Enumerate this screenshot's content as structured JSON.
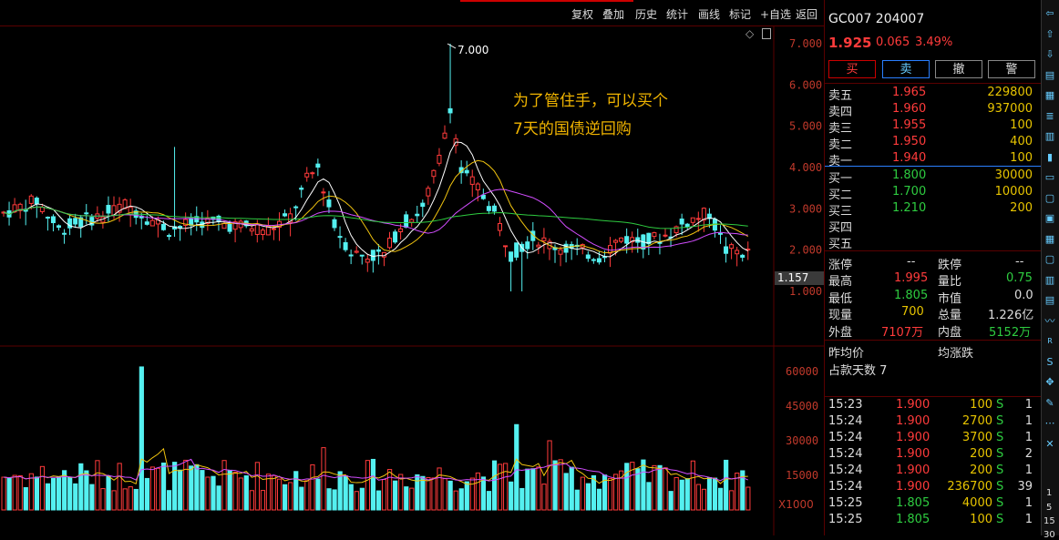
{
  "menu": [
    "复权",
    "叠加",
    "历史",
    "统计",
    "画线",
    "标记",
    "+自选",
    "返回"
  ],
  "chart": {
    "y_labels": [
      "7.000",
      "6.000",
      "5.000",
      "4.000",
      "3.000",
      "2.000",
      "1.000"
    ],
    "vol_labels": [
      "60000",
      "45000",
      "30000",
      "15000"
    ],
    "vol_unit": "X1000",
    "peak_label": "7.000",
    "current_price_tag": "1.157",
    "annotation_line1": "为了管住手，可以买个",
    "annotation_line2": "7天的国债逆回购"
  },
  "chart_data": {
    "type": "candlestick",
    "y_range": [
      0.6,
      7.2
    ],
    "volume_range": [
      0,
      65000
    ],
    "notes": "daily candlesticks with MA5/MA10/MA20/MA60 lines and volume bars"
  },
  "quote": {
    "code": "GC007 204007",
    "price": "1.925",
    "change": "0.065",
    "change_pct": "3.49%"
  },
  "actions": [
    "买",
    "卖",
    "撤",
    "警"
  ],
  "asks": [
    {
      "label": "卖五",
      "price": "1.965",
      "vol": "229800"
    },
    {
      "label": "卖四",
      "price": "1.960",
      "vol": "937000"
    },
    {
      "label": "卖三",
      "price": "1.955",
      "vol": "100"
    },
    {
      "label": "卖二",
      "price": "1.950",
      "vol": "400"
    },
    {
      "label": "卖一",
      "price": "1.940",
      "vol": "100"
    }
  ],
  "bids": [
    {
      "label": "买一",
      "price": "1.800",
      "vol": "30000"
    },
    {
      "label": "买二",
      "price": "1.700",
      "vol": "10000"
    },
    {
      "label": "买三",
      "price": "1.210",
      "vol": "200"
    },
    {
      "label": "买四",
      "price": "",
      "vol": ""
    },
    {
      "label": "买五",
      "price": "",
      "vol": ""
    }
  ],
  "stats": {
    "limit_up_label": "涨停",
    "limit_up": "--",
    "limit_down_label": "跌停",
    "limit_down": "--",
    "high_label": "最高",
    "high": "1.995",
    "ratio_label": "量比",
    "ratio": "0.75",
    "low_label": "最低",
    "low": "1.805",
    "mcap_label": "市值",
    "mcap": "0.0",
    "cur_vol_label": "现量",
    "cur_vol": "700",
    "total_vol_label": "总量",
    "total_vol": "1.226亿",
    "outer_label": "外盘",
    "outer": "7107万",
    "inner_label": "内盘",
    "inner": "5152万"
  },
  "extra": {
    "prev_avg_label": "昨均价",
    "avg_chg_label": "均涨跌",
    "days_label": "占款天数 7"
  },
  "ticks": [
    {
      "t": "15:23",
      "p": "1.900",
      "v": "100",
      "s": "S",
      "n": "1"
    },
    {
      "t": "15:24",
      "p": "1.900",
      "v": "2700",
      "s": "S",
      "n": "1"
    },
    {
      "t": "15:24",
      "p": "1.900",
      "v": "3700",
      "s": "S",
      "n": "1"
    },
    {
      "t": "15:24",
      "p": "1.900",
      "v": "200",
      "s": "S",
      "n": "2"
    },
    {
      "t": "15:24",
      "p": "1.900",
      "v": "200",
      "s": "S",
      "n": "1"
    },
    {
      "t": "15:24",
      "p": "1.900",
      "v": "236700",
      "s": "S",
      "n": "39"
    },
    {
      "t": "15:25",
      "p": "1.805",
      "v": "4000",
      "s": "S",
      "n": "1"
    },
    {
      "t": "15:25",
      "p": "1.805",
      "v": "100",
      "s": "S",
      "n": "1"
    }
  ],
  "toolbar": [
    "back-icon",
    "up-icon",
    "down-icon",
    "report-icon",
    "grid-icon",
    "list-icon",
    "chart-icon",
    "candle-icon",
    "doc-icon",
    "f10-icon",
    "info-icon",
    "table-icon",
    "f12-icon",
    "bar-icon",
    "settings-icon",
    "wave-icon",
    "rsi-icon",
    "s-icon",
    "nav-icon",
    "pen-icon",
    "dots-icon",
    "x-icon"
  ],
  "toolbar_text": {
    "one": "1",
    "five": "5",
    "fifteen": "15",
    "thirty": "30"
  }
}
